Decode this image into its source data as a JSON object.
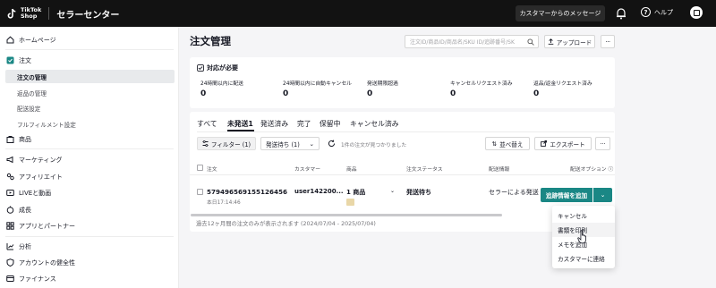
{
  "topbar": {
    "logo_line1": "TikTok",
    "logo_line2": "Shop",
    "title": "セラーセンター",
    "message_button": "カスタマーからのメッセージ",
    "help_label": "ヘルプ"
  },
  "sidebar": {
    "home": "ホームページ",
    "orders": "注文",
    "order_mgmt": "注文の管理",
    "returns": "返品の管理",
    "shipping_settings": "配送設定",
    "fulfillment_settings": "フルフィルメント設定",
    "products": "商品",
    "marketing": "マーケティング",
    "affiliate": "アフィリエイト",
    "live_video": "LIVEと動画",
    "growth": "成長",
    "apps_partners": "アプリとパートナー",
    "analytics": "分析",
    "account_health": "アカウントの健全性",
    "finance": "ファイナンス"
  },
  "main": {
    "title": "注文管理",
    "search_placeholder": "注文ID/商品ID/商品名/SKU ID/追跡番号/SK",
    "upload_label": "アップロード",
    "more_label": "···",
    "action_required": {
      "title": "対応が必要",
      "stats": [
        {
          "label": "24時間以内に配送",
          "value": "0"
        },
        {
          "label": "24時間以内に自動キャンセル",
          "value": "0"
        },
        {
          "label": "発送期限超過",
          "value": "0"
        },
        {
          "label": "キャンセルリクエスト済み",
          "value": "0"
        },
        {
          "label": "返品/返金リクエスト済み",
          "value": "0"
        }
      ]
    },
    "tabs": [
      "すべて",
      "未発送1",
      "発送済み",
      "完了",
      "保留中",
      "キャンセル済み"
    ],
    "filter_label": "フィルター (1)",
    "status_select": "発送待ち (1)",
    "found_text": "1件の注文が見つかりました",
    "sort_label": "並べ替え",
    "export_label": "エクスポート",
    "table": {
      "headers": [
        "注文",
        "カスタマー",
        "商品",
        "注文ステータス",
        "配送情報",
        "配送オプション"
      ],
      "row": {
        "order_id": "579496569155126456",
        "time": "本日17:14:46",
        "customer": "user142200...",
        "product": "1 商品",
        "status": "発送待ち",
        "shipping": "セラーによる発送",
        "action": "追跡情報を追加"
      }
    },
    "footer_note": "過去12ヶ月間の注文のみが表示されます (2024/07/04 - 2025/07/04)",
    "dropdown": [
      "キャンセル",
      "書類を印刷",
      "メモを追加",
      "カスタマーに連絡"
    ]
  },
  "colors": {
    "primary": "#1a8785",
    "topbar": "#121212"
  }
}
